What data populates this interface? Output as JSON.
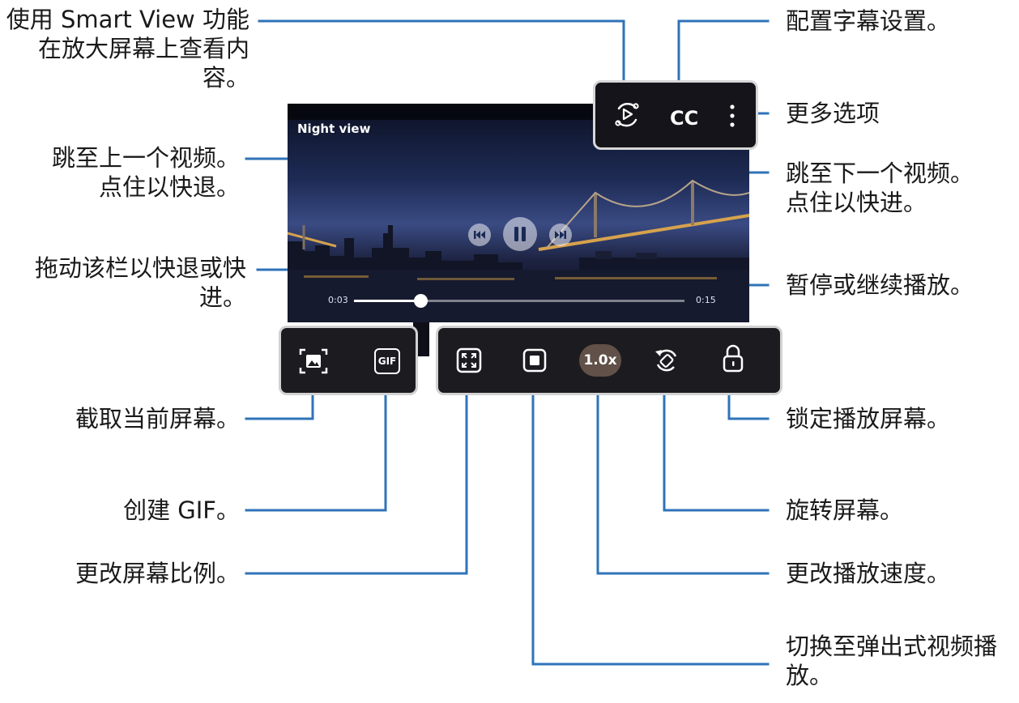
{
  "video": {
    "title": "Night view",
    "time_current": "0:03",
    "time_total": "0:15",
    "progress": 0.2
  },
  "top_bar": {
    "cc_label": "CC"
  },
  "bottom_bar": {
    "gif_label": "GIF",
    "speed_label": "1.0x"
  },
  "icons": [
    "smart-view-icon",
    "more-options-icon",
    "previous-icon",
    "pause-icon",
    "next-icon",
    "capture-icon",
    "gif-icon",
    "aspect-ratio-icon",
    "popup-play-icon",
    "rotate-icon",
    "lock-icon"
  ],
  "colors": {
    "callout_line": "#2f73b8",
    "bar_background": "#1c1b20",
    "bar_border": "#d2d2d2"
  },
  "callouts": {
    "smart_view": [
      "使用 Smart View 功能",
      "在放大屏幕上查看内",
      "容。"
    ],
    "previous": [
      "跳至上一个视频。",
      "点住以快退。"
    ],
    "seek": [
      "拖动该栏以快退或快",
      "进。"
    ],
    "capture": [
      "截取当前屏幕。"
    ],
    "gif": [
      "创建 GIF。"
    ],
    "ratio": [
      "更改屏幕比例。"
    ],
    "subtitle": [
      "配置字幕设置。"
    ],
    "more": [
      "更多选项"
    ],
    "next": [
      "跳至下一个视频。",
      "点住以快进。"
    ],
    "pause": [
      "暂停或继续播放。"
    ],
    "lock": [
      "锁定播放屏幕。"
    ],
    "rotate": [
      "旋转屏幕。"
    ],
    "speed": [
      "更改播放速度。"
    ],
    "popup": [
      "切换至弹出式视频播",
      "放。"
    ]
  }
}
